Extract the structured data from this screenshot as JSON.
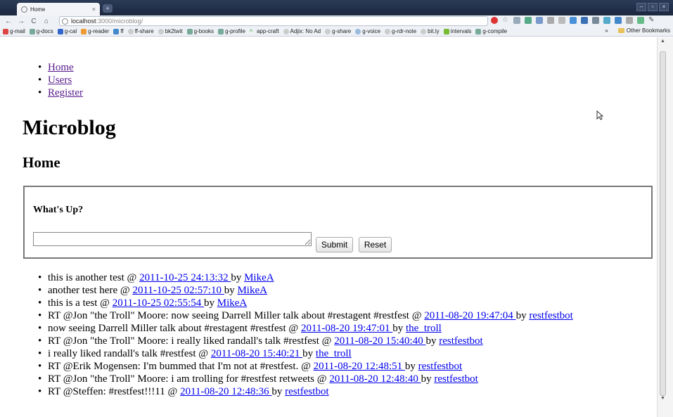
{
  "browser": {
    "tab_title": "Home",
    "tab_close": "×",
    "new_tab": "+",
    "url_host": "localhost",
    "url_path": ":3000/microblog/",
    "window_controls": [
      "–",
      "▫",
      "×"
    ],
    "bookmarks": [
      "g-mail",
      "g-docs",
      "g-cal",
      "g-reader",
      "ff",
      "ff-share",
      "bk2twit",
      "g-books",
      "g-profile",
      "app-craft",
      "Adjix: No Ad",
      "g-share",
      "g-voice",
      "g-rdr-note",
      "bit.ly",
      "intervals",
      "g-compile"
    ],
    "bookmarks_overflow": "»",
    "other_bookmarks": "Other Bookmarks"
  },
  "nav": {
    "home": "Home",
    "users": "Users",
    "register": "Register"
  },
  "page": {
    "title": "Microblog",
    "subtitle": "Home"
  },
  "form": {
    "prompt": "What's Up?",
    "input_value": "",
    "submit_label": "Submit",
    "reset_label": "Reset"
  },
  "posts": [
    {
      "text": "this is another test @ ",
      "date": "2011-10-25 24:13:32 ",
      "by": " by ",
      "user": "MikeA"
    },
    {
      "text": "another test here @ ",
      "date": "2011-10-25 02:57:10 ",
      "by": " by ",
      "user": "MikeA"
    },
    {
      "text": "this is a test @ ",
      "date": "2011-10-25 02:55:54 ",
      "by": " by ",
      "user": "MikeA"
    },
    {
      "text": "RT @Jon \"the Troll\" Moore: now seeing Darrell Miller talk about #restagent #restfest @ ",
      "date": "2011-08-20 19:47:04 ",
      "by": " by ",
      "user": "restfestbot"
    },
    {
      "text": "now seeing Darrell Miller talk about #restagent #restfest @ ",
      "date": "2011-08-20 19:47:01 ",
      "by": " by ",
      "user": "the_troll"
    },
    {
      "text": "RT @Jon \"the Troll\" Moore: i really liked randall's talk #restfest @ ",
      "date": "2011-08-20 15:40:40 ",
      "by": " by ",
      "user": "restfestbot"
    },
    {
      "text": "i really liked randall's talk #restfest @ ",
      "date": "2011-08-20 15:40:21 ",
      "by": " by ",
      "user": "the_troll"
    },
    {
      "text": "RT @Erik Mogensen: I'm bummed that I'm not at #restfest. @ ",
      "date": "2011-08-20 12:48:51 ",
      "by": " by ",
      "user": "restfestbot"
    },
    {
      "text": "RT @Jon \"the Troll\" Moore: i am trolling for #restfest retweets @ ",
      "date": "2011-08-20 12:48:40 ",
      "by": " by ",
      "user": "restfestbot"
    },
    {
      "text": "RT @Steffen: #restfest!!!11 @ ",
      "date": "2011-08-20 12:48:36 ",
      "by": " by ",
      "user": "restfestbot"
    }
  ]
}
